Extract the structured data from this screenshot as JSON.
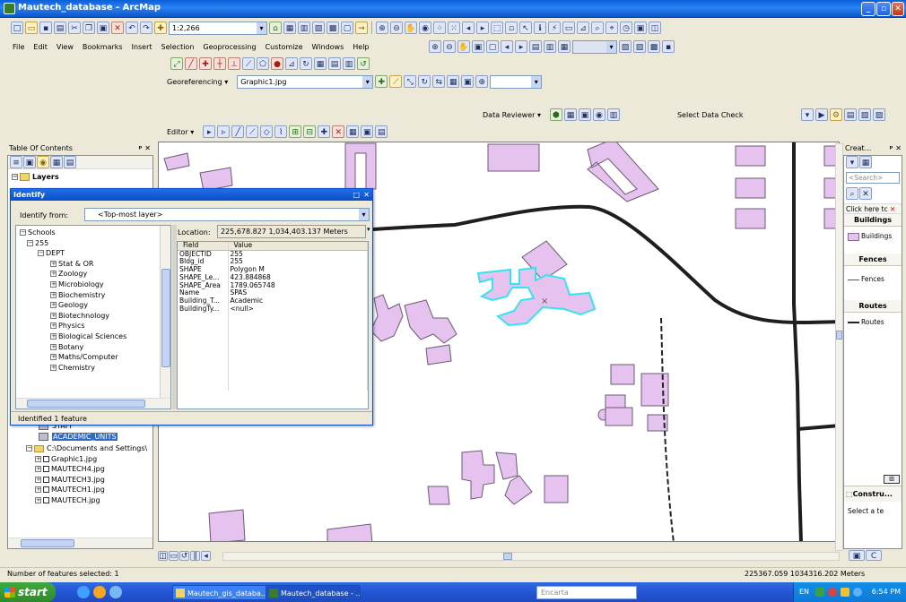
{
  "window": {
    "title": "Mautech_database - ArcMap"
  },
  "toolbar1": {
    "scale": "1:2,266"
  },
  "menu": [
    "File",
    "Edit",
    "View",
    "Bookmarks",
    "Insert",
    "Selection",
    "Geoprocessing",
    "Customize",
    "Windows",
    "Help"
  ],
  "georef": {
    "label": "Georeferencing ▾",
    "layer": "Graphic1.jpg"
  },
  "data_reviewer": {
    "label": "Data Reviewer ▾",
    "select_check": "Select Data Check"
  },
  "editor": {
    "label": "Editor ▾"
  },
  "toc": {
    "title": "Table Of Contents",
    "root": "Layers",
    "items_below": [
      "STAFF",
      "ACADEMIC_UNITS",
      "C:\\Documents and Settings\\",
      "Graphic1.jpg",
      "MAUTECH4.jpg",
      "MAUTECH3.jpg",
      "MAUTECH1.jpg",
      "MAUTECH.jpg"
    ]
  },
  "identify": {
    "title": "Identify",
    "from_label": "Identify from:",
    "from_value": "<Top-most layer>",
    "tree": [
      "Schools",
      "255",
      "DEPT",
      "Stat & OR",
      "Zoology",
      "Microbiology",
      "Biochemistry",
      "Geology",
      "Biotechnology",
      "Physics",
      "Biological Sciences",
      "Botany",
      "Maths/Computer",
      "Chemistry"
    ],
    "location_label": "Location:",
    "location_value": "225,678.827  1,034,403.137 Meters",
    "header": {
      "field": "Field",
      "value": "Value"
    },
    "rows": [
      {
        "field": "OBJECTID",
        "value": "255"
      },
      {
        "field": "Bldg_id",
        "value": "255"
      },
      {
        "field": "SHAPE",
        "value": "Polygon M"
      },
      {
        "field": "SHAPE_Le...",
        "value": "423.884868"
      },
      {
        "field": "SHAPE_Area",
        "value": "1789.065748"
      },
      {
        "field": "Name",
        "value": "SPAS"
      },
      {
        "field": "Building_T...",
        "value": "Academic"
      },
      {
        "field": "BuildingTy...",
        "value": "<null>"
      }
    ],
    "footer": "Identified 1 feature"
  },
  "create": {
    "title": "Creat...",
    "search": "<Search>",
    "click_here": "Click here tc",
    "groups": [
      {
        "header": "Buildings",
        "item": "Buildings",
        "color": "#E5C3EE"
      },
      {
        "header": "Fences",
        "item": "Fences",
        "color": "#555555"
      },
      {
        "header": "Routes",
        "item": "Routes",
        "color": "#222222"
      }
    ],
    "construct": "Constru...",
    "select_a": "Select a te"
  },
  "status": {
    "left": "Number of features selected: 1",
    "coords": "225367.059  1034316.202 Meters"
  },
  "taskbar": {
    "start": "start",
    "tasks": [
      "Mautech_gis_databa...",
      "Mautech_database - ..."
    ],
    "search": "Encarta",
    "lang": "EN",
    "clock": "6:54 PM"
  },
  "colors": {
    "building": "#E5C3EE",
    "selected": "#34E4EE",
    "route": "#1E1E1E"
  }
}
